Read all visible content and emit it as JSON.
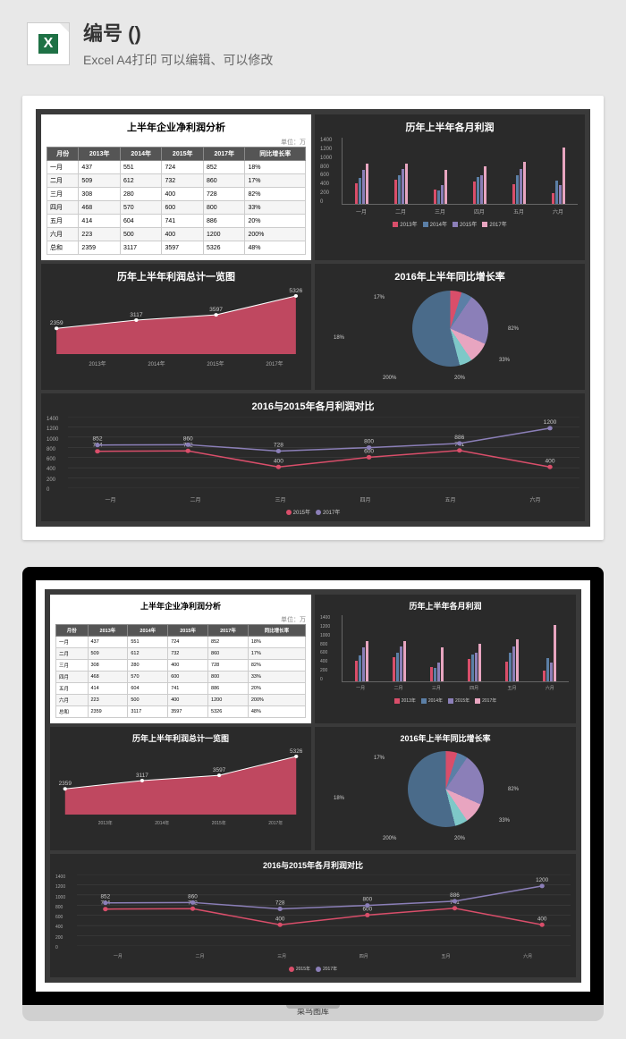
{
  "header": {
    "title": "编号 ()",
    "subtitle": "Excel A4打印 可以编辑、可以修改",
    "icon_letter": "X"
  },
  "dashboard": {
    "table_panel": {
      "title": "上半年企业净利润分析",
      "unit": "单位：万",
      "headers": [
        "月份",
        "2013年",
        "2014年",
        "2015年",
        "2017年",
        "同比增长率"
      ],
      "rows": [
        [
          "一月",
          "437",
          "551",
          "724",
          "852",
          "18%"
        ],
        [
          "二月",
          "509",
          "612",
          "732",
          "860",
          "17%"
        ],
        [
          "三月",
          "308",
          "280",
          "400",
          "728",
          "82%"
        ],
        [
          "四月",
          "468",
          "570",
          "600",
          "800",
          "33%"
        ],
        [
          "五月",
          "414",
          "604",
          "741",
          "886",
          "20%"
        ],
        [
          "六月",
          "223",
          "500",
          "400",
          "1200",
          "200%"
        ],
        [
          "总和",
          "2359",
          "3117",
          "3597",
          "5326",
          "48%"
        ]
      ]
    },
    "bar_panel": {
      "title": "历年上半年各月利润",
      "legend": [
        "2013年",
        "2014年",
        "2015年",
        "2017年"
      ]
    },
    "area_panel": {
      "title": "历年上半年利润总计一览图"
    },
    "pie_panel": {
      "title": "2016年上半年同比增长率"
    },
    "line_panel": {
      "title": "2016与2015年各月利润对比",
      "legend": [
        "2015年",
        "2017年"
      ]
    }
  },
  "laptop_watermark": "菜鸟图库",
  "chart_data": [
    {
      "type": "table",
      "title": "上半年企业净利润分析",
      "columns": [
        "月份",
        "2013年",
        "2014年",
        "2015年",
        "2017年",
        "同比增长率"
      ],
      "data": [
        [
          "一月",
          437,
          551,
          724,
          852,
          "18%"
        ],
        [
          "二月",
          509,
          612,
          732,
          860,
          "17%"
        ],
        [
          "三月",
          308,
          280,
          400,
          728,
          "82%"
        ],
        [
          "四月",
          468,
          570,
          600,
          800,
          "33%"
        ],
        [
          "五月",
          414,
          604,
          741,
          886,
          "20%"
        ],
        [
          "六月",
          223,
          500,
          400,
          1200,
          "200%"
        ],
        [
          "总和",
          2359,
          3117,
          3597,
          5326,
          "48%"
        ]
      ]
    },
    {
      "type": "bar",
      "title": "历年上半年各月利润",
      "categories": [
        "一月",
        "二月",
        "三月",
        "四月",
        "五月",
        "六月"
      ],
      "series": [
        {
          "name": "2013年",
          "values": [
            437,
            509,
            308,
            468,
            414,
            223
          ],
          "color": "#d94e6a"
        },
        {
          "name": "2014年",
          "values": [
            551,
            612,
            280,
            570,
            604,
            500
          ],
          "color": "#5b7fa6"
        },
        {
          "name": "2015年",
          "values": [
            724,
            732,
            400,
            600,
            741,
            400
          ],
          "color": "#8b7fb8"
        },
        {
          "name": "2017年",
          "values": [
            852,
            860,
            728,
            800,
            886,
            1200
          ],
          "color": "#e8a5c0"
        }
      ],
      "ylim": [
        0,
        1400
      ],
      "yticks": [
        0,
        200,
        400,
        600,
        800,
        1000,
        1200,
        1400
      ]
    },
    {
      "type": "area",
      "title": "历年上半年利润总计一览图",
      "categories": [
        "2013年",
        "2014年",
        "2015年",
        "2017年"
      ],
      "values": [
        2359,
        3117,
        3597,
        5326
      ],
      "color": "#d94e6a"
    },
    {
      "type": "pie",
      "title": "2016年上半年同比增长率",
      "labels": [
        "18%",
        "17%",
        "82%",
        "33%",
        "20%",
        "200%"
      ],
      "slices": [
        {
          "label": "18%",
          "color": "#d94e6a"
        },
        {
          "label": "17%",
          "color": "#5b7fa6"
        },
        {
          "label": "82%",
          "color": "#8b7fb8"
        },
        {
          "label": "33%",
          "color": "#e8a5c0"
        },
        {
          "label": "20%",
          "color": "#7ec8c8"
        },
        {
          "label": "200%",
          "color": "#4a6b8a"
        }
      ]
    },
    {
      "type": "line",
      "title": "2016与2015年各月利润对比",
      "categories": [
        "一月",
        "二月",
        "三月",
        "四月",
        "五月",
        "六月"
      ],
      "series": [
        {
          "name": "2015年",
          "values": [
            724,
            732,
            400,
            600,
            741,
            400
          ],
          "color": "#d94e6a"
        },
        {
          "name": "2017年",
          "values": [
            852,
            860,
            728,
            800,
            886,
            1200
          ],
          "color": "#8b7fb8"
        }
      ],
      "ylim": [
        0,
        1400
      ],
      "yticks": [
        0,
        200,
        400,
        600,
        800,
        1000,
        1200,
        1400
      ],
      "data_labels": {
        "2015年": [
          724,
          732,
          400,
          600,
          741,
          400
        ],
        "2017年": [
          852,
          860,
          728,
          800,
          886,
          1200
        ]
      }
    }
  ]
}
